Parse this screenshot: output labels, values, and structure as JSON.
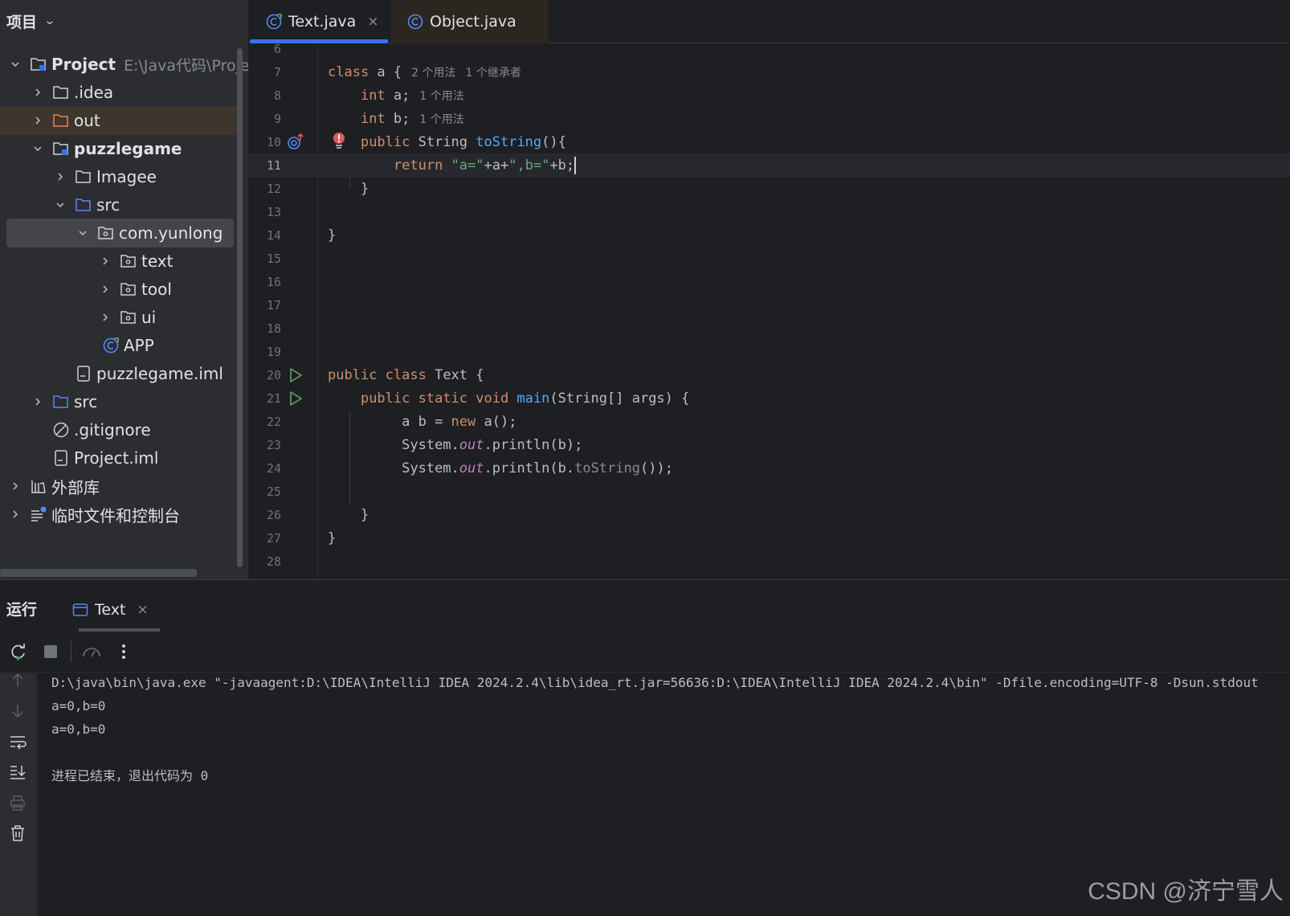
{
  "project_panel": {
    "title": "项目",
    "tree": [
      {
        "label": "Project",
        "path": "E:\\Java代码\\Projec",
        "icon": "module-folder-icon",
        "expanded": true
      },
      {
        "label": ".idea",
        "icon": "folder-icon"
      },
      {
        "label": "out",
        "icon": "excluded-folder-icon"
      },
      {
        "label": "puzzlegame",
        "icon": "module-folder-icon",
        "expanded": true
      },
      {
        "label": "Imagee",
        "icon": "folder-icon"
      },
      {
        "label": "src",
        "icon": "source-folder-icon",
        "expanded": true
      },
      {
        "label": "com.yunlong",
        "icon": "package-icon",
        "expanded": true
      },
      {
        "label": "text",
        "icon": "package-icon"
      },
      {
        "label": "tool",
        "icon": "package-icon"
      },
      {
        "label": "ui",
        "icon": "package-icon"
      },
      {
        "label": "APP",
        "icon": "java-class-icon"
      },
      {
        "label": "puzzlegame.iml",
        "icon": "iml-file-icon"
      },
      {
        "label": "src",
        "icon": "source-folder-icon"
      },
      {
        "label": ".gitignore",
        "icon": "ignored-file-icon"
      },
      {
        "label": "Project.iml",
        "icon": "iml-file-icon"
      },
      {
        "label": "外部库",
        "icon": "library-icon"
      },
      {
        "label": "临时文件和控制台",
        "icon": "scratches-icon"
      }
    ]
  },
  "editor_tabs": [
    {
      "label": "Text.java",
      "active": true,
      "close": "×"
    },
    {
      "label": "Object.java",
      "active": false
    }
  ],
  "editor": {
    "line_numbers": [
      "6",
      "7",
      "8",
      "9",
      "10",
      "11",
      "12",
      "13",
      "14",
      "15",
      "16",
      "17",
      "18",
      "19",
      "20",
      "21",
      "22",
      "23",
      "24",
      "25",
      "26",
      "27",
      "28"
    ],
    "hints": {
      "line7": [
        "2 个用法",
        "1 个继承者"
      ],
      "line8": "1 个用法",
      "line9": "1 个用法"
    },
    "code": {
      "l7_class": "class",
      "l7_rest": " a {",
      "l8_int": "int",
      "l8_rest": " a;",
      "l9_int": "int",
      "l9_rest": " b;",
      "l10_public": "public",
      "l10_type": " String ",
      "l10_fn": "toString",
      "l10_rest": "(){",
      "l11_return": "return",
      "l11_s1": "\"a=\"",
      "l11_p1": "+a+",
      "l11_s2": "\",b=\"",
      "l11_p2": "+b;",
      "l12": "}",
      "l14": "}",
      "l20_public": "public",
      "l20_class": " class",
      "l20_rest": " Text {",
      "l21_kw": "public static void",
      "l21_fn": " main",
      "l21_rest": "(String[] args) {",
      "l22_a": "a b = ",
      "l22_new": "new",
      "l22_rest": " a();",
      "l23_sys": "System.",
      "l23_out": "out",
      "l23_rest": ".println(b);",
      "l24_sys": "System.",
      "l24_out": "out",
      "l24_mid": ".println(b.",
      "l24_ts": "toString",
      "l24_rest": "());",
      "l26": "}",
      "l27": "}"
    }
  },
  "run_panel": {
    "title": "运行",
    "tab_label": "Text",
    "tab_close": "×",
    "console_lines": [
      "D:\\java\\bin\\java.exe \"-javaagent:D:\\IDEA\\IntelliJ IDEA 2024.2.4\\lib\\idea_rt.jar=56636:D:\\IDEA\\IntelliJ IDEA 2024.2.4\\bin\" -Dfile.encoding=UTF-8 -Dsun.stdout",
      "a=0,b=0",
      "a=0,b=0",
      "",
      "进程已结束，退出代码为 0"
    ]
  },
  "watermark": "CSDN @济宁雪人",
  "colors": {
    "accent": "#3574f0",
    "keyword": "#cf8e6d",
    "function": "#56a8f5",
    "string": "#6aab73",
    "static_field": "#c77dba",
    "run_green": "#57965c"
  }
}
